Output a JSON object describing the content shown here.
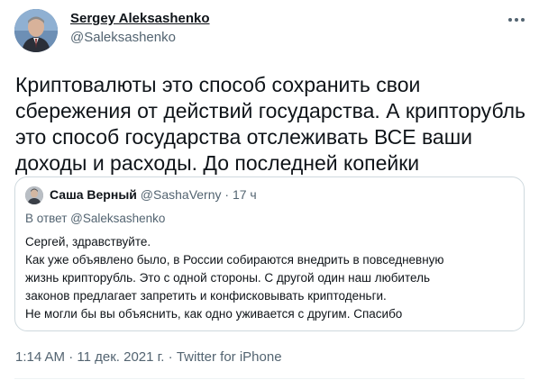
{
  "author": {
    "name": "Sergey Aleksashenko",
    "handle": "@Saleksashenko"
  },
  "tweet": {
    "lines": [
      "Криптовалюты это способ сохранить свои",
      "сбережения от действий государства. А крипторубль",
      "это способ государства отслеживать ВСЕ ваши",
      "доходы и расходы. До последней копейки"
    ]
  },
  "quote": {
    "author_name": "Саша Верный",
    "author_handle": "@SashaVerny",
    "separator": " · ",
    "time": "17 ч",
    "reply_to": "В ответ @Saleksashenko",
    "lines": [
      "Сергей, здравствуйте.",
      "Как уже объявлено было, в России собираются внедрить в повседневную",
      "жизнь крипторубль. Это с одной стороны. С другой один наш любитель",
      "законов предлагает запретить и конфисковывать криптоденьги.",
      "Не могли бы вы объяснить, как одно уживается с другим. Спасибо"
    ]
  },
  "footer": {
    "time": "1:14 AM",
    "sep1": " · ",
    "date": "11 дек. 2021 г.",
    "sep2": " · ",
    "source": "Twitter for iPhone"
  },
  "icons": {
    "more": "more-horizontal-icon"
  }
}
